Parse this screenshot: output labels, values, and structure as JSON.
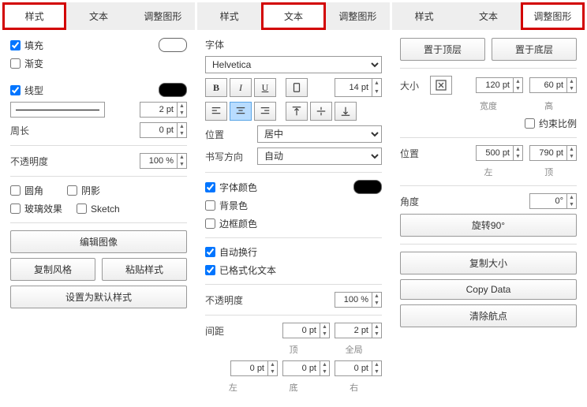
{
  "tabs": {
    "style": "样式",
    "text": "文本",
    "arrange": "调整图形"
  },
  "p1": {
    "fill": "填充",
    "gradient": "渐变",
    "line": "线型",
    "line_w": "2 pt",
    "perimeter": "周长",
    "perimeter_v": "0 pt",
    "opacity": "不透明度",
    "opacity_v": "100 %",
    "rounded": "圆角",
    "shadow": "阴影",
    "glass": "玻璃效果",
    "sketch": "Sketch",
    "editImage": "编辑图像",
    "copyStyle": "复制风格",
    "pasteStyle": "粘贴样式",
    "setDefault": "设置为默认样式"
  },
  "p2": {
    "font": "字体",
    "fontName": "Helvetica",
    "fontSize": "14 pt",
    "position": "位置",
    "positionV": "居中",
    "writeDir": "书写方向",
    "writeDirV": "自动",
    "fontColor": "字体颜色",
    "bgColor": "背景色",
    "borderColor": "边框颜色",
    "wrap": "自动换行",
    "formatted": "已格式化文本",
    "opacity": "不透明度",
    "opacity_v": "100 %",
    "spacing": "间距",
    "top_l": "顶",
    "global_l": "全局",
    "left_l": "左",
    "bottom_l": "底",
    "right_l": "右",
    "top_v": "0 pt",
    "global_v": "2 pt",
    "left_v": "0 pt",
    "bottom_v": "0 pt",
    "right_v": "0 pt"
  },
  "p3": {
    "toFront": "置于顶层",
    "toBack": "置于底层",
    "size": "大小",
    "width": "宽度",
    "height": "高",
    "width_v": "120 pt",
    "height_v": "60 pt",
    "constrain": "约束比例",
    "position": "位置",
    "left": "左",
    "top": "顶",
    "left_v": "500 pt",
    "top_v": "790 pt",
    "angle": "角度",
    "angle_v": "0°",
    "rotate90": "旋转90°",
    "copySize": "复制大小",
    "copyData": "Copy Data",
    "clearWaypoints": "清除航点"
  }
}
